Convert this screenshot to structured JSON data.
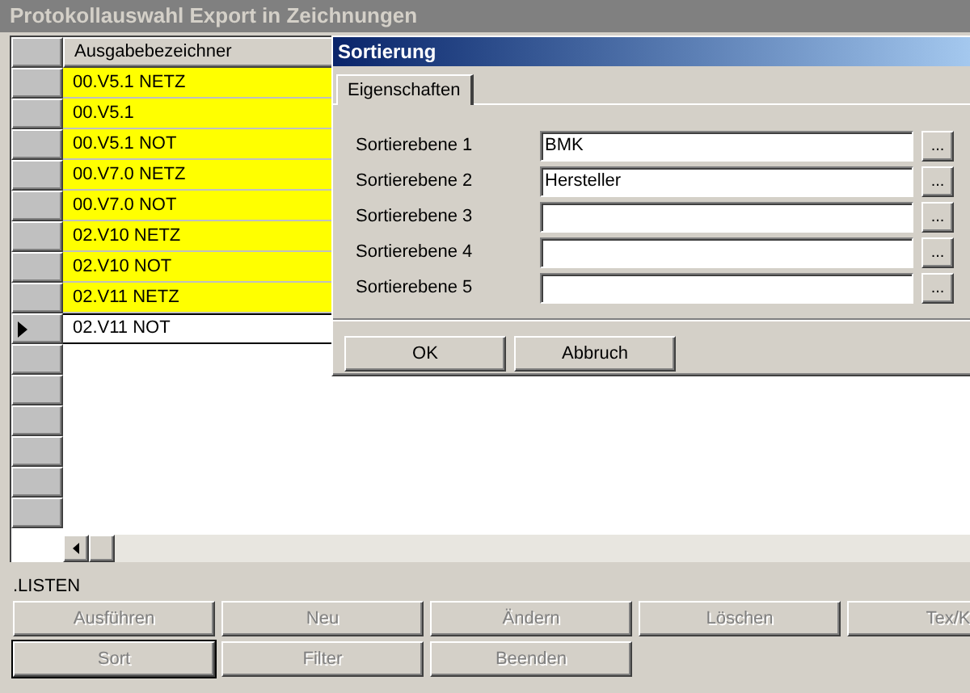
{
  "window": {
    "title": "Protokollauswahl Export in Zeichnungen"
  },
  "table": {
    "columns": [
      "Ausgabebezeichner"
    ],
    "rows": [
      {
        "value": "00.V5.1 NETZ",
        "highlighted": true,
        "selected": false
      },
      {
        "value": "00.V5.1",
        "highlighted": true,
        "selected": false
      },
      {
        "value": "00.V5.1 NOT",
        "highlighted": true,
        "selected": false
      },
      {
        "value": "00.V7.0 NETZ",
        "highlighted": true,
        "selected": false
      },
      {
        "value": "00.V7.0 NOT",
        "highlighted": true,
        "selected": false
      },
      {
        "value": "02.V10 NETZ",
        "highlighted": true,
        "selected": false
      },
      {
        "value": "02.V10 NOT",
        "highlighted": true,
        "selected": false
      },
      {
        "value": "02.V11 NETZ",
        "highlighted": true,
        "selected": false
      },
      {
        "value": "02.V11 NOT",
        "highlighted": false,
        "selected": true
      }
    ]
  },
  "section_label": ".LISTEN",
  "buttons": [
    [
      {
        "label": "Ausführen",
        "disabled": true,
        "default": false
      },
      {
        "label": "Neu",
        "disabled": true,
        "default": false
      },
      {
        "label": "Ändern",
        "disabled": true,
        "default": false
      },
      {
        "label": "Löschen",
        "disabled": true,
        "default": false
      },
      {
        "label": "Tex/K",
        "disabled": true,
        "default": false
      }
    ],
    [
      {
        "label": "Sort",
        "disabled": true,
        "default": true
      },
      {
        "label": "Filter",
        "disabled": true,
        "default": false
      },
      {
        "label": "Beenden",
        "disabled": true,
        "default": false
      }
    ]
  ],
  "dialog": {
    "title": "Sortierung",
    "tabs": [
      {
        "label": "Eigenschaften",
        "selected": true
      }
    ],
    "fields": [
      {
        "label": "Sortierebene 1",
        "value": "BMK",
        "button": "..."
      },
      {
        "label": "Sortierebene 2",
        "value": "Hersteller",
        "button": "..."
      },
      {
        "label": "Sortierebene 3",
        "button": "..."
      },
      {
        "label": "Sortierebene 4",
        "button": "..."
      },
      {
        "label": "Sortierebene 5",
        "button": "..."
      }
    ],
    "buttons": [
      "OK",
      "Abbruch"
    ]
  }
}
